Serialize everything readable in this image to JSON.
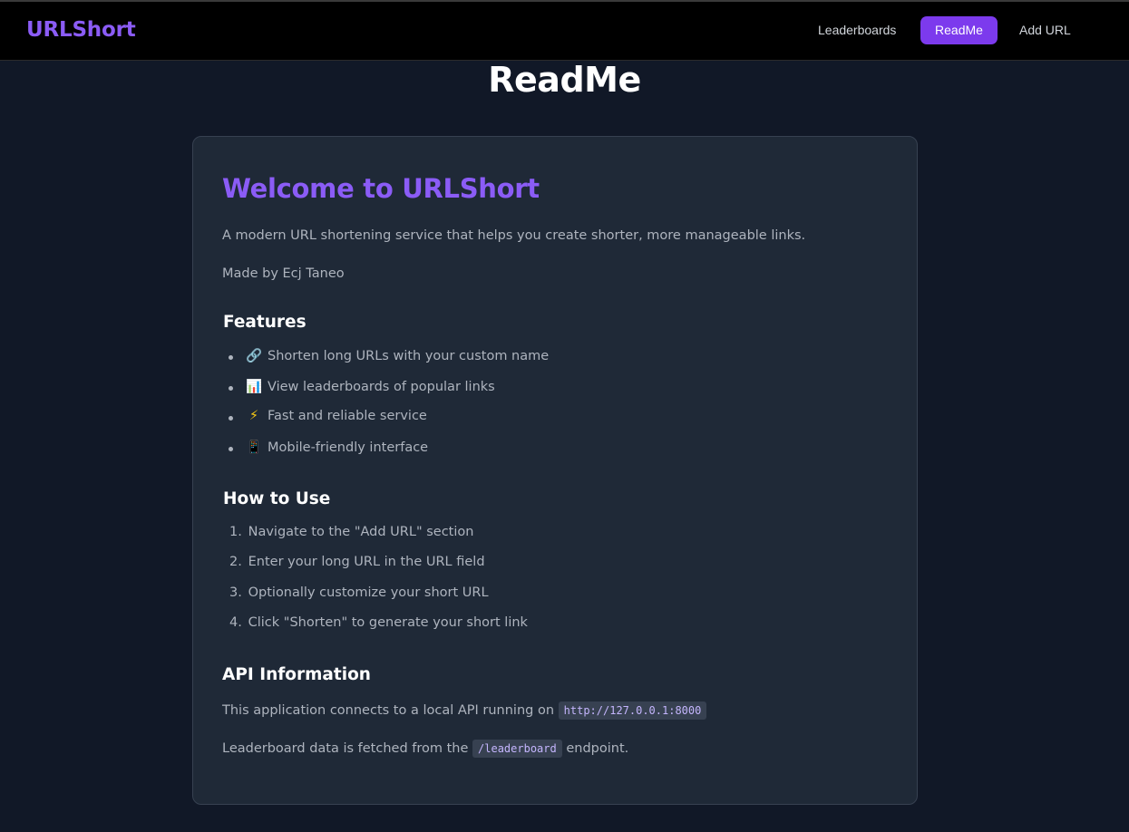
{
  "app": {
    "brand": "URLShort"
  },
  "nav": {
    "leaderboards": "Leaderboards",
    "readme": "ReadMe",
    "add_url": "Add URL"
  },
  "page": {
    "title": "ReadMe"
  },
  "card": {
    "welcome": "Welcome to URLShort",
    "description": "A modern URL shortening service that helps you create shorter, more manageable links.",
    "made_by": "Made by Ecj Taneo",
    "features_heading": "Features",
    "features": [
      {
        "icon": "🔗",
        "icon_name": "link-icon",
        "text": "Shorten long URLs with your custom name"
      },
      {
        "icon": "📊",
        "icon_name": "chart-icon",
        "text": "View leaderboards of popular links"
      },
      {
        "icon": "⚡",
        "icon_name": "lightning-icon",
        "text": "Fast and reliable service"
      },
      {
        "icon": "📱",
        "icon_name": "mobile-phone-icon",
        "text": "Mobile-friendly interface"
      }
    ],
    "howto_heading": "How to Use",
    "steps": [
      {
        "num": "1.",
        "text": "Navigate to the \"Add URL\" section"
      },
      {
        "num": "2.",
        "text": "Enter your long URL in the URL field"
      },
      {
        "num": "3.",
        "text": "Optionally customize your short URL"
      },
      {
        "num": "4.",
        "text": "Click \"Shorten\" to generate your short link"
      }
    ],
    "api_heading": "API Information",
    "api_text1_prefix": "This application connects to a local API running on",
    "api_url": "http://127.0.0.1:8000",
    "api_text2_prefix": "Leaderboard data is fetched from the",
    "api_endpoint": "/leaderboard",
    "api_text2_suffix": "endpoint."
  },
  "colors": {
    "accent": "#8b5cf6",
    "active_nav": "#7c3aed",
    "background": "#111827",
    "card": "#1f2937"
  }
}
